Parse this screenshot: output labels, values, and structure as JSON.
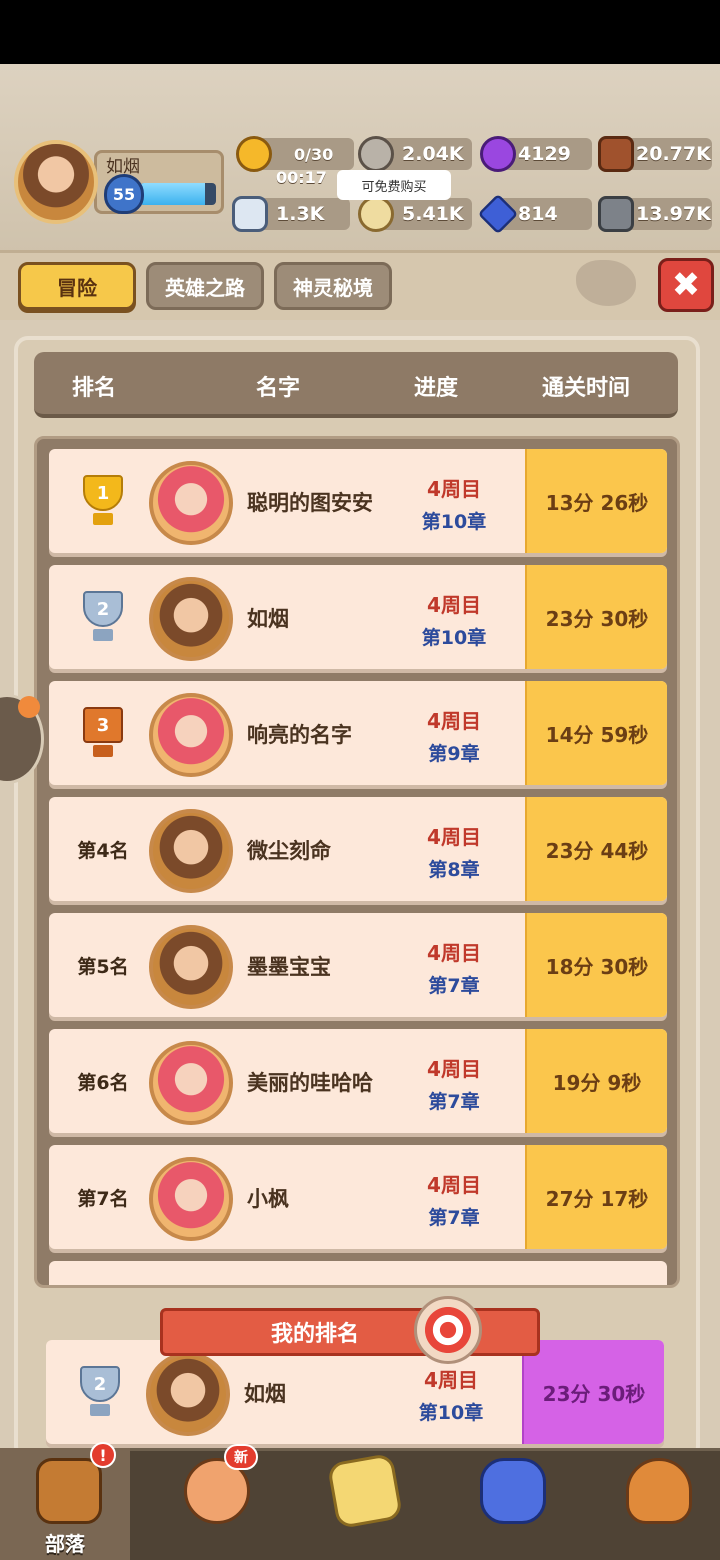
{
  "player": {
    "name": "如烟",
    "level": "55",
    "xp_fraction": 0.85
  },
  "resources": {
    "food": "0/30",
    "food_timer": "00:17",
    "stone_ore": "2.04K",
    "purple_gem": "4129",
    "wood": "20.77K",
    "bone": "1.3K",
    "egg": "5.41K",
    "diamond": "814",
    "rock": "13.97K",
    "tooltip": "可免费购买"
  },
  "tabs": [
    {
      "label": "冒险",
      "active": true
    },
    {
      "label": "英雄之路",
      "active": false
    },
    {
      "label": "神灵秘境",
      "active": false
    }
  ],
  "table": {
    "headers": [
      "排名",
      "名字",
      "进度",
      "通关时间"
    ],
    "rows": [
      {
        "rank": "1",
        "rank_type": "gold",
        "name": "聪明的图安安",
        "round": "4周目",
        "chapter": "第10章",
        "time": "13分 26秒"
      },
      {
        "rank": "2",
        "rank_type": "silver",
        "name": "如烟",
        "round": "4周目",
        "chapter": "第10章",
        "time": "23分 30秒"
      },
      {
        "rank": "3",
        "rank_type": "bronze",
        "name": "响亮的名字",
        "round": "4周目",
        "chapter": "第9章",
        "time": "14分 59秒"
      },
      {
        "rank": "第4名",
        "rank_type": "text",
        "name": "微尘刻命",
        "round": "4周目",
        "chapter": "第8章",
        "time": "23分 44秒"
      },
      {
        "rank": "第5名",
        "rank_type": "text",
        "name": "墨墨宝宝",
        "round": "4周目",
        "chapter": "第7章",
        "time": "18分 30秒"
      },
      {
        "rank": "第6名",
        "rank_type": "text",
        "name": "美丽的哇哈哈",
        "round": "4周目",
        "chapter": "第7章",
        "time": "19分 9秒"
      },
      {
        "rank": "第7名",
        "rank_type": "text",
        "name": "小枫",
        "round": "4周目",
        "chapter": "第7章",
        "time": "27分 17秒"
      }
    ]
  },
  "my_rank": {
    "banner": "我的排名",
    "rank": "2",
    "name": "如烟",
    "round": "4周目",
    "chapter": "第10章",
    "time": "23分 30秒"
  },
  "bottom_nav": {
    "tribe_label": "部落",
    "tribe_badge": "!",
    "hero_badge": "新"
  },
  "colors": {
    "accent_gold": "#fbc64c",
    "my_time_purple": "#d562e6",
    "close_red": "#e0473e"
  }
}
